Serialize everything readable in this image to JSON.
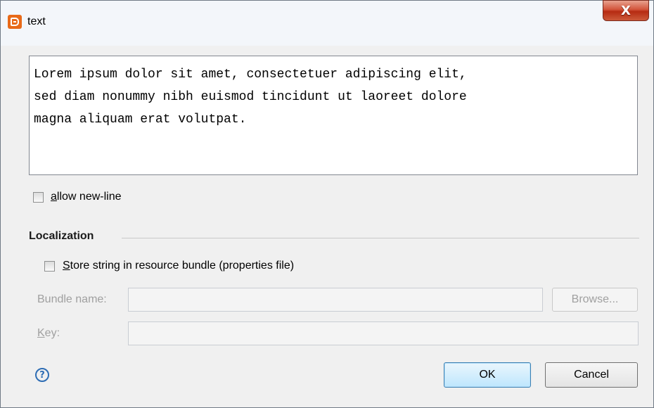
{
  "window": {
    "title": "text",
    "close_glyph": "X",
    "app_icon": "designer-app-icon"
  },
  "editor": {
    "text": "Lorem ipsum dolor sit amet, consectetuer adipiscing elit,\nsed diam nonummy nibh euismod tincidunt ut laoreet dolore\nmagna aliquam erat volutpat."
  },
  "allow_newline": {
    "mnemonic": "a",
    "rest": "llow new-line",
    "checked": false
  },
  "localization": {
    "title": "Localization",
    "store": {
      "mnemonic": "S",
      "rest": "tore string in resource bundle (properties file)",
      "checked": false
    },
    "bundle_name_label": "Bundle name:",
    "bundle_name_value": "",
    "browse": {
      "mnemonic": "B",
      "rest": "rowse..."
    },
    "key_label": {
      "mnemonic": "K",
      "rest": "ey:"
    },
    "key_value": ""
  },
  "footer": {
    "help_glyph": "?",
    "ok_label": "OK",
    "cancel_label": "Cancel"
  },
  "colors": {
    "accent": "#3c7fb1",
    "app_icon": "#e86a19",
    "close": "#c2442a",
    "disabled_text": "#a0a0a0"
  }
}
